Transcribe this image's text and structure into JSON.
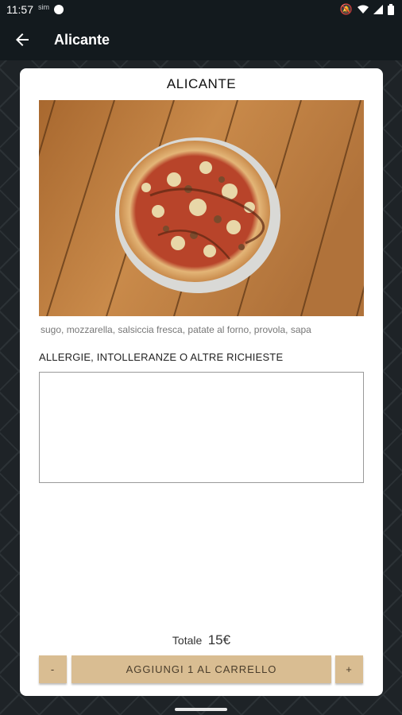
{
  "status_bar": {
    "time": "11:57",
    "sim_label": "sim"
  },
  "app_bar": {
    "title": "Alicante"
  },
  "product": {
    "name": "ALICANTE",
    "ingredients": "sugo, mozzarella, salsiccia fresca, patate al forno, provola, sapa",
    "allergy_label": "ALLERGIE, INTOLLERANZE O ALTRE RICHIESTE",
    "notes_value": "",
    "total_label": "Totale",
    "total_value": "15€"
  },
  "actions": {
    "minus_label": "-",
    "add_label": "AGGIUNGI 1 AL CARRELLO",
    "plus_label": "+"
  },
  "colors": {
    "bar_bg": "#131a1e",
    "button_bg": "#d9bd92",
    "card_bg": "#ffffff"
  },
  "icons": [
    "back-arrow-icon",
    "mute-icon",
    "wifi-icon",
    "signal-icon",
    "battery-icon"
  ]
}
